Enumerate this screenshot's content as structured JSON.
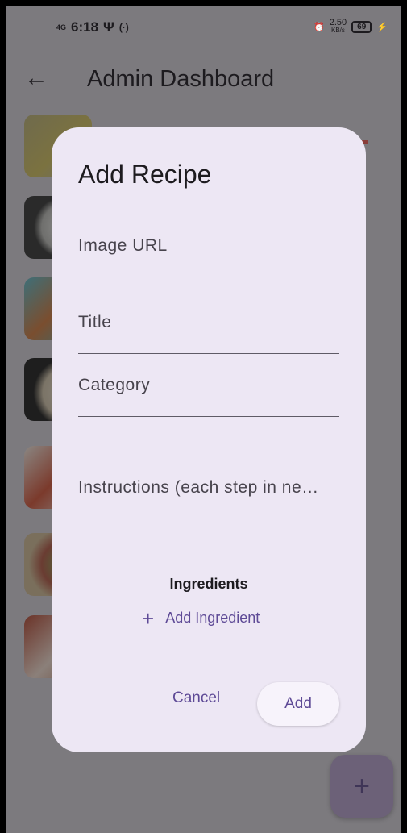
{
  "status_bar": {
    "network": "4G",
    "time": "6:18",
    "speed": "2.50",
    "speed_unit": "KB/s",
    "battery": "69"
  },
  "app_bar": {
    "title": "Admin Dashboard"
  },
  "dialog": {
    "title": "Add Recipe",
    "fields": {
      "image_url": "Image URL",
      "title": "Title",
      "category": "Category",
      "instructions": "Instructions (each step in ne…"
    },
    "ingredients_heading": "Ingredients",
    "add_ingredient": "Add Ingredient",
    "cancel": "Cancel",
    "add": "Add"
  },
  "fab": {
    "label": "+"
  },
  "colors": {
    "accent": "#5e4a96",
    "dialog_bg": "#ede7f4",
    "scrim": "#7c7a7e"
  }
}
